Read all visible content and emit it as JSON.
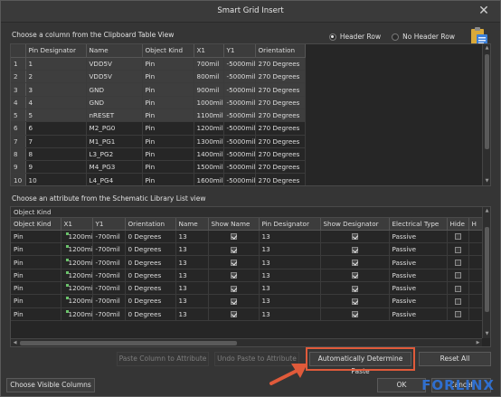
{
  "window": {
    "title": "Smart Grid Insert"
  },
  "clipboard": {
    "label": "Choose a column from the Clipboard Table View",
    "header_row_label": "Header Row",
    "no_header_row_label": "No Header Row",
    "header_row_selected": true,
    "columns": [
      "Pin Designator",
      "Name",
      "Object Kind",
      "X1",
      "Y1",
      "Orientation"
    ],
    "rows": [
      [
        "1",
        "1",
        "VDD5V",
        "Pin",
        "700mil",
        "-5000mil",
        "270 Degrees"
      ],
      [
        "2",
        "2",
        "VDD5V",
        "Pin",
        "800mil",
        "-5000mil",
        "270 Degrees"
      ],
      [
        "3",
        "3",
        "GND",
        "Pin",
        "900mil",
        "-5000mil",
        "270 Degrees"
      ],
      [
        "4",
        "4",
        "GND",
        "Pin",
        "1000mil",
        "-5000mil",
        "270 Degrees"
      ],
      [
        "5",
        "5",
        "nRESET",
        "Pin",
        "1100mil",
        "-5000mil",
        "270 Degrees"
      ],
      [
        "6",
        "6",
        "M2_PG0",
        "Pin",
        "1200mil",
        "-5000mil",
        "270 Degrees"
      ],
      [
        "7",
        "7",
        "M1_PG1",
        "Pin",
        "1300mil",
        "-5000mil",
        "270 Degrees"
      ],
      [
        "8",
        "8",
        "L3_PG2",
        "Pin",
        "1400mil",
        "-5000mil",
        "270 Degrees"
      ],
      [
        "9",
        "9",
        "M4_PG3",
        "Pin",
        "1500mil",
        "-5000mil",
        "270 Degrees"
      ],
      [
        "10",
        "10",
        "L4_PG4",
        "Pin",
        "1600mil",
        "-5000mil",
        "270 Degrees"
      ]
    ],
    "selected_rows": 5
  },
  "schematic": {
    "label": "Choose an attribute from the Schematic Library List view",
    "group_header": "Object Kind",
    "columns": [
      "Object Kind",
      "X1",
      "Y1",
      "Orientation",
      "Name",
      "Show Name",
      "Pin Designator",
      "Show Designator",
      "Electrical Type",
      "Hide",
      "H"
    ],
    "rows": [
      [
        "Pin",
        "1200mil",
        "-700mil",
        "0 Degrees",
        "13",
        "13",
        "Passive"
      ],
      [
        "Pin",
        "1200mil",
        "-700mil",
        "0 Degrees",
        "13",
        "13",
        "Passive"
      ],
      [
        "Pin",
        "1200mil",
        "-700mil",
        "0 Degrees",
        "13",
        "13",
        "Passive"
      ],
      [
        "Pin",
        "1200mil",
        "-700mil",
        "0 Degrees",
        "13",
        "13",
        "Passive"
      ],
      [
        "Pin",
        "1200mil",
        "-700mil",
        "0 Degrees",
        "13",
        "13",
        "Passive"
      ],
      [
        "Pin",
        "1200mil",
        "-700mil",
        "0 Degrees",
        "13",
        "13",
        "Passive"
      ],
      [
        "Pin",
        "1200mil",
        "-700mil",
        "0 Degrees",
        "13",
        "13",
        "Passive"
      ]
    ]
  },
  "buttons": {
    "paste_column": "Paste Column to Attribute",
    "undo_paste": "Undo Paste to Attribute",
    "auto_paste": "Automatically Determine Paste",
    "reset_all": "Reset All",
    "choose_columns": "Choose Visible Columns",
    "ok": "OK",
    "cancel": "Cancel"
  },
  "watermark": "FORLINX",
  "colors": {
    "highlight": "#e05a3a",
    "accent": "#2f6fd0"
  }
}
